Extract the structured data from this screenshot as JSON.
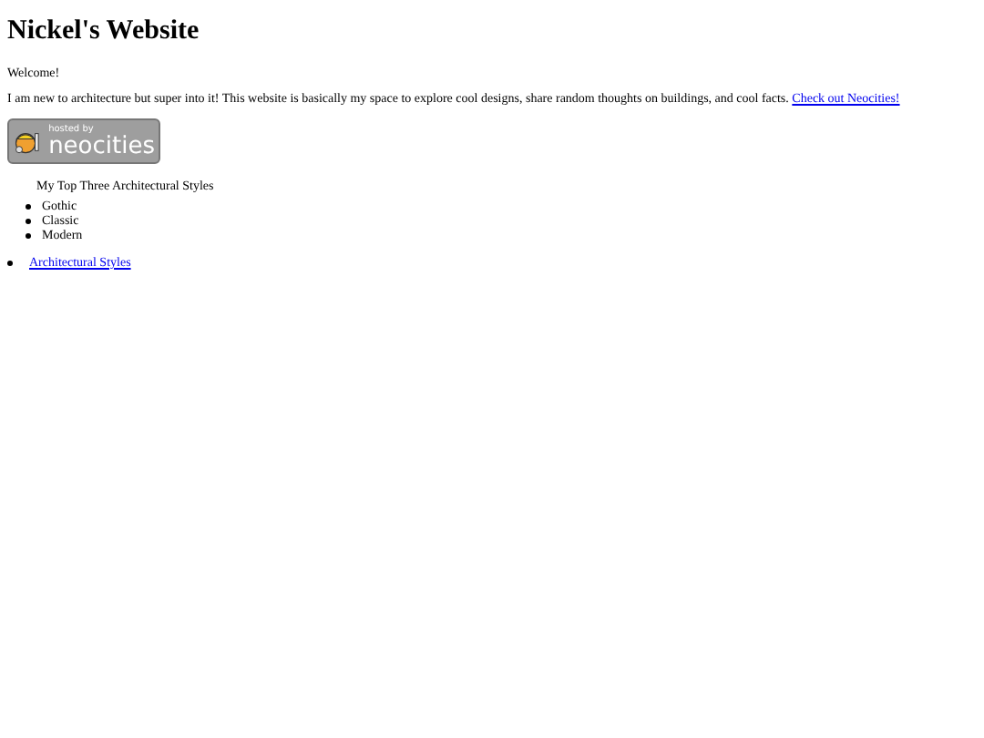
{
  "heading": "Nickel's Website",
  "welcome": "Welcome!",
  "intro": "I am new to architecture but super into it! This website is basically my space to explore cool designs, share random thoughts on buildings, and cool facts.",
  "intro_link": "Check out Neocities!",
  "badge": {
    "small": "hosted by",
    "big": "neocities"
  },
  "list_title": "My Top Three Architectural Styles",
  "styles": [
    "Gothic",
    "Classic",
    "Modern"
  ],
  "nav_links": [
    "Architectural Styles"
  ]
}
